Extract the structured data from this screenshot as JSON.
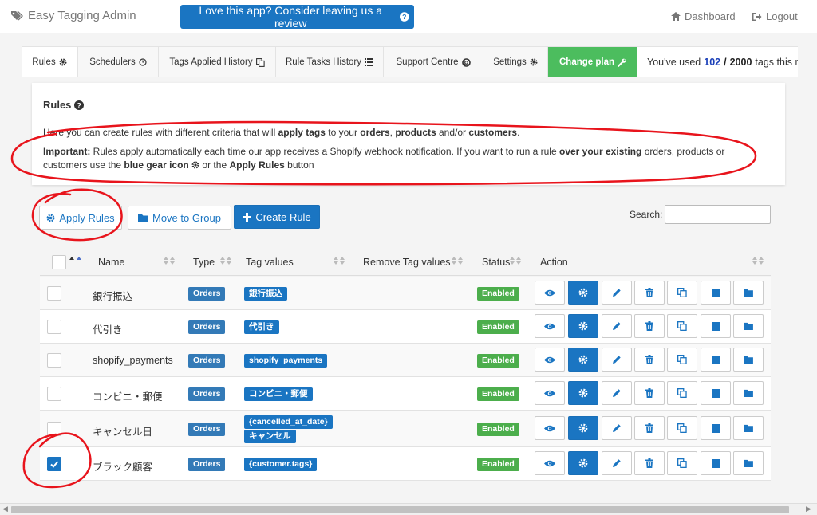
{
  "header": {
    "brand": "Easy Tagging Admin",
    "review_button": "Love this app? Consider leaving us a review",
    "dashboard": "Dashboard",
    "logout": "Logout"
  },
  "tabs": [
    {
      "label": "Rules",
      "icon": "gear-icon"
    },
    {
      "label": "Schedulers",
      "icon": "clock-icon"
    },
    {
      "label": "Tags Applied History",
      "icon": "copy-icon"
    },
    {
      "label": "Rule Tasks History",
      "icon": "list-icon"
    },
    {
      "label": "Support Centre",
      "icon": "lifebuoy-icon"
    },
    {
      "label": "Settings",
      "icon": "gear-icon"
    },
    {
      "label": "Change plan",
      "icon": "wrench-icon"
    }
  ],
  "usage": {
    "prefix": "You've used",
    "used": "102",
    "sep": "/",
    "total": "2000",
    "suffix": "tags this mont"
  },
  "info": {
    "title": "Rules",
    "p1_a": "Here you can create rules with different criteria that will ",
    "p1_b": "apply tags",
    "p1_c": " to your ",
    "p1_d": "orders",
    "p1_e": ", ",
    "p1_f": "products",
    "p1_g": " and/or ",
    "p1_h": "customers",
    "p1_i": ".",
    "p2_a": "Important:",
    "p2_b": " Rules apply automatically each time our app receives a Shopify webhook notification. If you want to run a rule ",
    "p2_c": "over your existing",
    "p2_d": " orders, products or customers use the ",
    "p2_e": "blue gear icon",
    "p2_f": " or the ",
    "p2_g": "Apply Rules",
    "p2_h": " button"
  },
  "toolbar": {
    "apply_rules": "Apply Rules",
    "move_to_group": "Move to Group",
    "create_rule": "Create Rule",
    "search_label": "Search:",
    "search_value": ""
  },
  "table": {
    "columns": [
      "Name",
      "Type",
      "Tag values",
      "Remove Tag values",
      "Status",
      "Action"
    ],
    "rows": [
      {
        "name": "銀行振込",
        "type": "Orders",
        "tags": [
          "銀行振込"
        ],
        "status": "Enabled",
        "checked": false
      },
      {
        "name": "代引き",
        "type": "Orders",
        "tags": [
          "代引き"
        ],
        "status": "Enabled",
        "checked": false
      },
      {
        "name": "shopify_payments",
        "type": "Orders",
        "tags": [
          "shopify_payments"
        ],
        "status": "Enabled",
        "checked": false
      },
      {
        "name": "コンビニ・郵便",
        "type": "Orders",
        "tags": [
          "コンビニ・郵便"
        ],
        "status": "Enabled",
        "checked": false
      },
      {
        "name": "キャンセル日",
        "type": "Orders",
        "tags": [
          "{cancelled_at_date}",
          "キャンセル"
        ],
        "status": "Enabled",
        "checked": false
      },
      {
        "name": "ブラック顧客",
        "type": "Orders",
        "tags": [
          "{customer.tags}"
        ],
        "status": "Enabled",
        "checked": true
      }
    ],
    "actions": [
      "eye-icon",
      "gear-icon",
      "pencil-icon",
      "trash-icon",
      "copy-icon",
      "stop-icon",
      "folder-icon"
    ]
  },
  "colors": {
    "primary": "#1a75c2",
    "success": "#4cae4c",
    "plan": "#4cbd5e",
    "annotation": "#e8141c"
  }
}
